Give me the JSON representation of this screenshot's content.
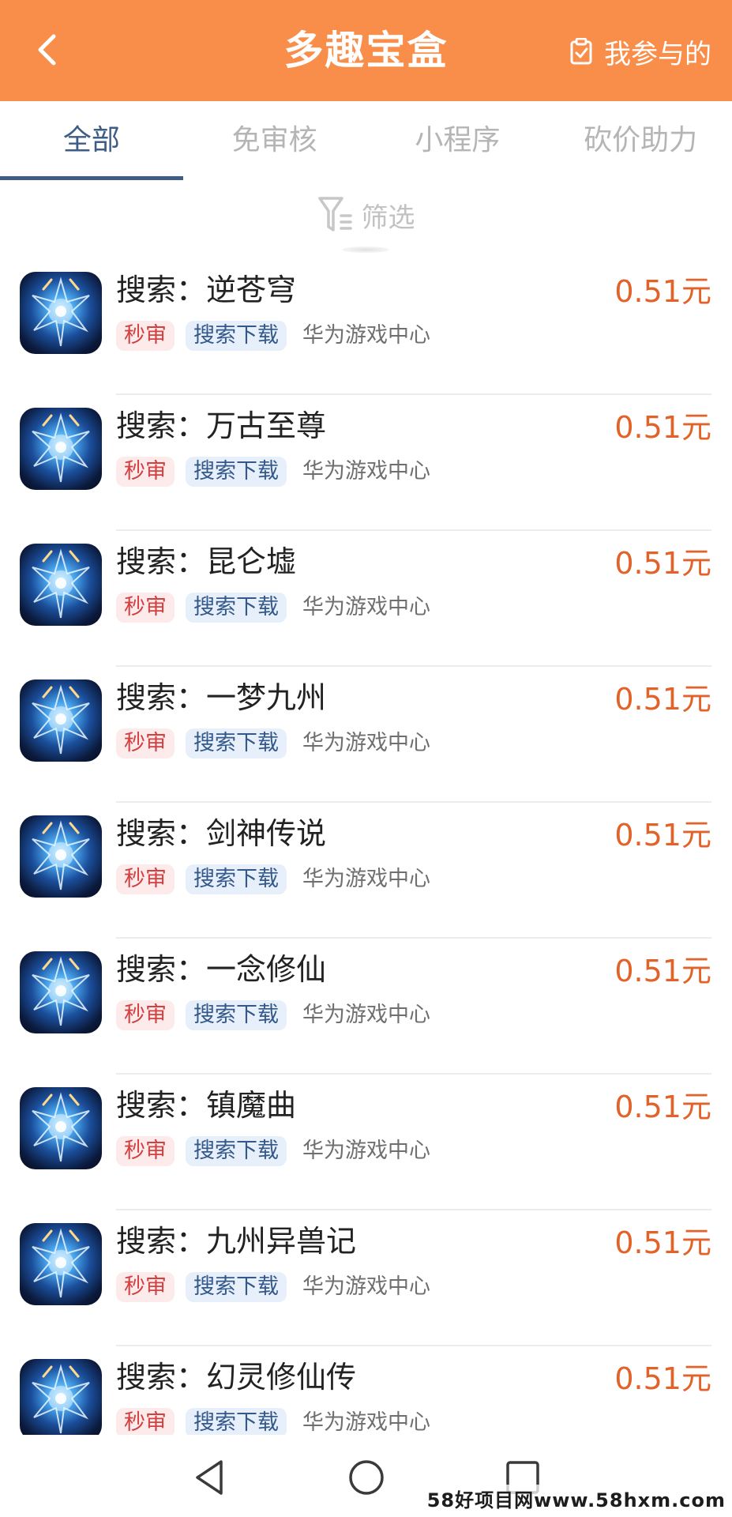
{
  "header": {
    "title": "多趣宝盒",
    "mine_label": "我参与的",
    "background": "#f98d4a"
  },
  "tabs": [
    {
      "label": "全部",
      "active": true
    },
    {
      "label": "免审核",
      "active": false
    },
    {
      "label": "小程序",
      "active": false
    },
    {
      "label": "砍价助力",
      "active": false
    }
  ],
  "filter": {
    "label": "筛选"
  },
  "items": [
    {
      "title": "搜索：逆苍穹",
      "tag1": "秒审",
      "tag2": "搜索下载",
      "source": "华为游戏中心",
      "price": "0.51元"
    },
    {
      "title": "搜索：万古至尊",
      "tag1": "秒审",
      "tag2": "搜索下载",
      "source": "华为游戏中心",
      "price": "0.51元"
    },
    {
      "title": "搜索：昆仑墟",
      "tag1": "秒审",
      "tag2": "搜索下载",
      "source": "华为游戏中心",
      "price": "0.51元"
    },
    {
      "title": "搜索：一梦九州",
      "tag1": "秒审",
      "tag2": "搜索下载",
      "source": "华为游戏中心",
      "price": "0.51元"
    },
    {
      "title": "搜索：剑神传说",
      "tag1": "秒审",
      "tag2": "搜索下载",
      "source": "华为游戏中心",
      "price": "0.51元"
    },
    {
      "title": "搜索：一念修仙",
      "tag1": "秒审",
      "tag2": "搜索下载",
      "source": "华为游戏中心",
      "price": "0.51元"
    },
    {
      "title": "搜索：镇魔曲",
      "tag1": "秒审",
      "tag2": "搜索下载",
      "source": "华为游戏中心",
      "price": "0.51元"
    },
    {
      "title": "搜索：九州异兽记",
      "tag1": "秒审",
      "tag2": "搜索下载",
      "source": "华为游戏中心",
      "price": "0.51元"
    },
    {
      "title": "搜索：幻灵修仙传",
      "tag1": "秒审",
      "tag2": "搜索下载",
      "source": "华为游戏中心",
      "price": "0.51元"
    }
  ],
  "navbar": {
    "icons": [
      "back-triangle-icon",
      "home-circle-icon",
      "recents-square-icon"
    ]
  },
  "watermark": "58好项目网www.58hxm.com"
}
